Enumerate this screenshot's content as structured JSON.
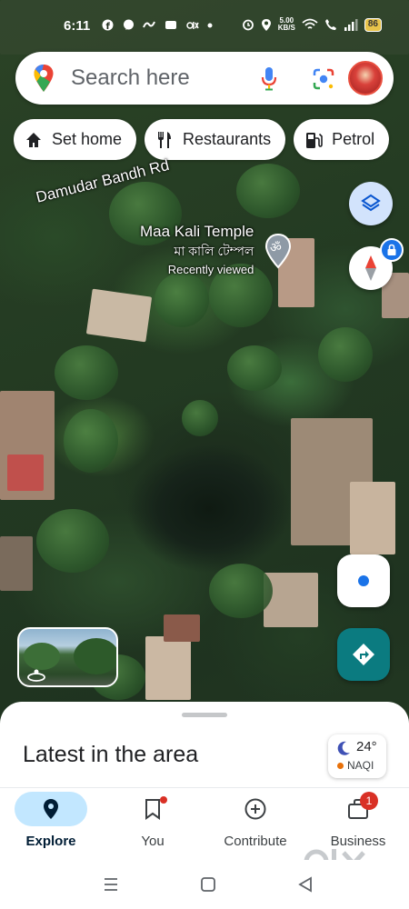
{
  "status_bar": {
    "time": "6:11",
    "network_speed": "5.00",
    "network_speed_unit": "KB/S",
    "battery": "86"
  },
  "search": {
    "placeholder": "Search here"
  },
  "chips": [
    {
      "label": "Set home",
      "icon": "home-icon"
    },
    {
      "label": "Restaurants",
      "icon": "restaurant-icon"
    },
    {
      "label": "Petrol",
      "icon": "gas-station-icon"
    }
  ],
  "map": {
    "road_label": "Damudar Bandh Rd",
    "place": {
      "name": "Maa Kali Temple",
      "local_name": "মা কালি টেম্পল",
      "subtitle": "Recently viewed",
      "icon": "om-temple-icon"
    }
  },
  "sheet": {
    "title": "Latest in the area",
    "weather": {
      "temperature": "24°",
      "aqi_label": "NAQI",
      "icon": "moon-icon"
    }
  },
  "bottom_nav": [
    {
      "label": "Explore",
      "icon": "explore-pin-icon",
      "active": true
    },
    {
      "label": "You",
      "icon": "bookmark-icon",
      "badge": "dot"
    },
    {
      "label": "Contribute",
      "icon": "add-circle-icon"
    },
    {
      "label": "Business",
      "icon": "storefront-icon",
      "badge": "1"
    }
  ],
  "colors": {
    "accent_blue": "#1a73e8",
    "directions_teal": "#0b7b80",
    "active_pill": "#c2e7ff",
    "badge_red": "#d93025"
  }
}
